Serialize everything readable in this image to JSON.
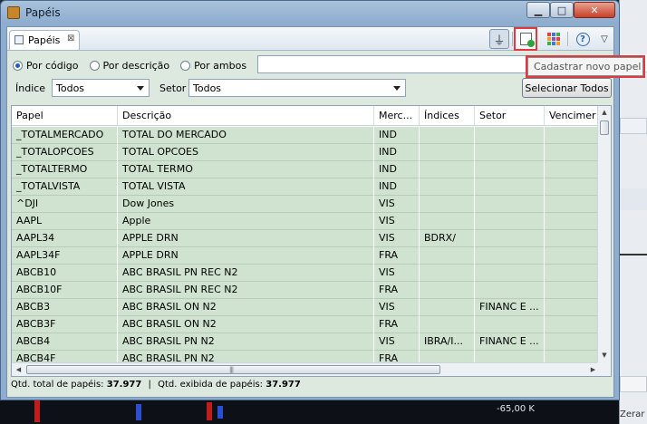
{
  "window": {
    "title": "Papéis"
  },
  "view_tab": {
    "label": "Papéis"
  },
  "tooltip": {
    "text": "Cadastrar novo papel"
  },
  "search": {
    "options": [
      "Por código",
      "Por descrição",
      "Por ambos"
    ],
    "selected_index": 0,
    "value": ""
  },
  "filters": {
    "indice_label": "Índice",
    "indice_value": "Todos",
    "setor_label": "Setor",
    "setor_value": "Todos",
    "select_all_label": "Selecionar Todos"
  },
  "table": {
    "columns": [
      "Papel",
      "Descrição",
      "Merc...",
      "Índices",
      "Setor",
      "Vencimer"
    ],
    "rows": [
      [
        "_TOTALMERCADO",
        "TOTAL DO MERCADO",
        "IND",
        "",
        "",
        ""
      ],
      [
        "_TOTALOPCOES",
        "TOTAL OPCOES",
        "IND",
        "",
        "",
        ""
      ],
      [
        "_TOTALTERMO",
        "TOTAL TERMO",
        "IND",
        "",
        "",
        ""
      ],
      [
        "_TOTALVISTA",
        "TOTAL VISTA",
        "IND",
        "",
        "",
        ""
      ],
      [
        "^DJI",
        "Dow Jones",
        "VIS",
        "",
        "",
        ""
      ],
      [
        "AAPL",
        "Apple",
        "VIS",
        "",
        "",
        ""
      ],
      [
        "AAPL34",
        "APPLE DRN",
        "VIS",
        "BDRX/",
        "",
        ""
      ],
      [
        "AAPL34F",
        "APPLE DRN",
        "FRA",
        "",
        "",
        ""
      ],
      [
        "ABCB10",
        "ABC BRASIL PN REC N2",
        "VIS",
        "",
        "",
        ""
      ],
      [
        "ABCB10F",
        "ABC BRASIL PN REC N2",
        "FRA",
        "",
        "",
        ""
      ],
      [
        "ABCB3",
        "ABC BRASIL ON N2",
        "VIS",
        "",
        "FINANC E ...",
        ""
      ],
      [
        "ABCB3F",
        "ABC BRASIL ON N2",
        "FRA",
        "",
        "",
        ""
      ],
      [
        "ABCB4",
        "ABC BRASIL PN N2",
        "VIS",
        "IBRA/I...",
        "FINANC E ...",
        ""
      ],
      [
        "ABCB4F",
        "ABC BRASIL PN N2",
        "FRA",
        "",
        "",
        ""
      ]
    ]
  },
  "status": {
    "total_label": "Qtd. total de papéis:",
    "total_value": "37.977",
    "separator": "|",
    "shown_label": "Qtd. exibida de papéis:",
    "shown_value": "37.977"
  },
  "background": {
    "price_label": "-65,00 K",
    "zerar_label": "Zerar"
  },
  "colors": {
    "row_bg": "#cfe3d0",
    "highlight": "#e0393e",
    "panel_bg": "#dde9de"
  }
}
